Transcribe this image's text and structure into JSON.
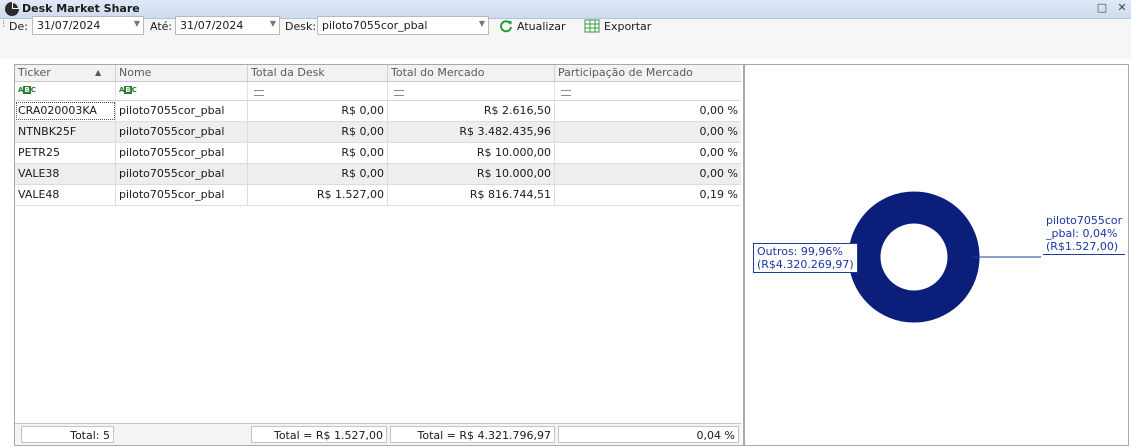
{
  "window": {
    "title": "Desk Market Share",
    "maximize_glyph": "□",
    "close_glyph": "✕"
  },
  "toolbar": {
    "from_label": "De:",
    "from_value": "31/07/2024",
    "to_label": "Até:",
    "to_value": "31/07/2024",
    "desk_label": "Desk:",
    "desk_value": "piloto7055cor_pbal",
    "refresh_label": "Atualizar",
    "export_label": "Exportar",
    "refresh_icon": "refresh-icon",
    "export_icon": "spreadsheet-export-icon"
  },
  "grid": {
    "columns": [
      "Ticker",
      "Nome",
      "Total da Desk",
      "Total do Mercado",
      "Participação de Mercado"
    ],
    "sort_indicator": "▲",
    "rows": [
      {
        "ticker": "CRA020003KA",
        "nome": "piloto7055cor_pbal",
        "desk": "R$ 0,00",
        "mercado": "R$ 2.616,50",
        "part": "0,00 %"
      },
      {
        "ticker": "NTNBK25F",
        "nome": "piloto7055cor_pbal",
        "desk": "R$ 0,00",
        "mercado": "R$ 3.482.435,96",
        "part": "0,00 %"
      },
      {
        "ticker": "PETR25",
        "nome": "piloto7055cor_pbal",
        "desk": "R$ 0,00",
        "mercado": "R$ 10.000,00",
        "part": "0,00 %"
      },
      {
        "ticker": "VALE38",
        "nome": "piloto7055cor_pbal",
        "desk": "R$ 0,00",
        "mercado": "R$ 10.000,00",
        "part": "0,00 %"
      },
      {
        "ticker": "VALE48",
        "nome": "piloto7055cor_pbal",
        "desk": "R$ 1.527,00",
        "mercado": "R$ 816.744,51",
        "part": "0,19 %"
      }
    ],
    "footer": {
      "count": "Total: 5",
      "desk_total": "Total = R$ 1.527,00",
      "market_total": "Total = R$ 4.321.796,97",
      "share_total": "0,04 %"
    }
  },
  "chart_data": {
    "type": "pie",
    "donut": true,
    "slices": [
      {
        "label": "Outros",
        "percent": 99.96,
        "value": 4320269.97,
        "callout_lines": [
          "Outros: 99,96%",
          "(R$4.320.269,97)"
        ],
        "color": "#0b1f7a"
      },
      {
        "label": "piloto7055cor_pbal",
        "percent": 0.04,
        "value": 1527.0,
        "callout_lines": [
          "piloto7055cor",
          "_pbal: 0,04%",
          "(R$1.527,00)"
        ],
        "color": "#0b1f7a"
      }
    ]
  },
  "colors": {
    "donut": "#0b1f7a",
    "callout_text": "#1a37a5",
    "refresh_green": "#2e9b3a"
  }
}
